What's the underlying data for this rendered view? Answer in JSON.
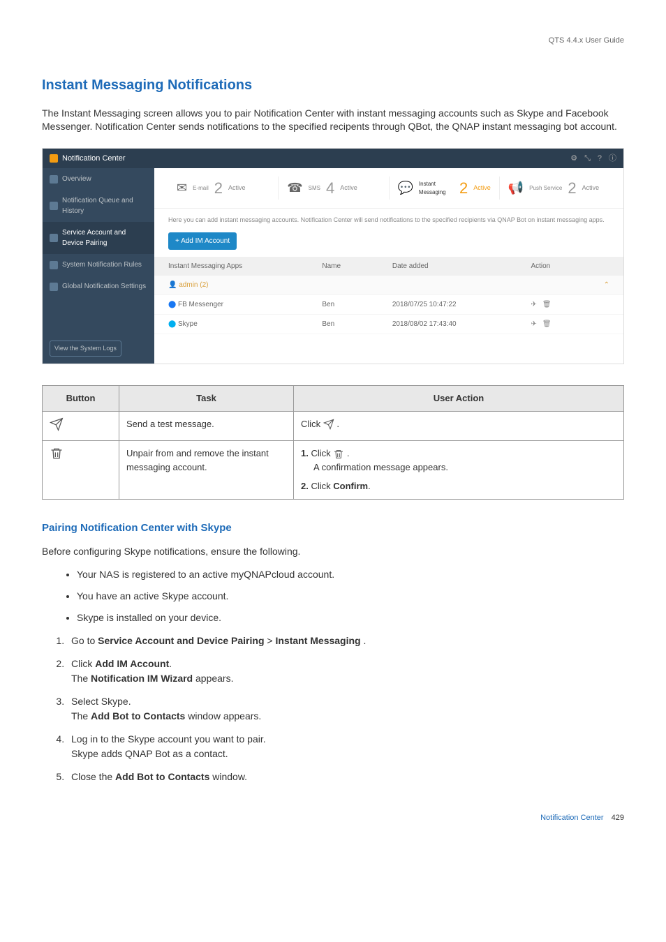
{
  "header": {
    "guide_title": "QTS 4.4.x User Guide"
  },
  "section": {
    "title": "Instant Messaging Notifications",
    "intro": "The Instant Messaging screen allows you to pair Notification Center with instant messaging accounts such as Skype and Facebook Messenger. Notification Center sends notifications to the specified recipents through QBot, the QNAP instant messaging bot account."
  },
  "screenshot": {
    "titlebar": "Notification Center",
    "sidebar": {
      "items": [
        {
          "label": "Overview"
        },
        {
          "label": "Notification Queue and History"
        },
        {
          "label": "Service Account and Device Pairing"
        },
        {
          "label": "System Notification Rules"
        },
        {
          "label": "Global Notification Settings"
        }
      ],
      "bottom_button": "View the System Logs"
    },
    "stats": [
      {
        "icon": "✉",
        "num": "2",
        "label": "Active",
        "sub": "E-mail"
      },
      {
        "icon": "☎",
        "num": "4",
        "label": "Active",
        "sub": "SMS"
      },
      {
        "icon": "💬",
        "num": "2",
        "label": "Active",
        "sub": "Instant Messaging",
        "highlight": true
      },
      {
        "icon": "📢",
        "num": "2",
        "label": "Active",
        "sub": "Push Service"
      }
    ],
    "desc": "Here you can add instant messaging accounts. Notification Center will send notifications to the specified recipients via QNAP Bot on instant messaging apps.",
    "add_button": "+ Add IM Account",
    "table": {
      "headers": [
        "Instant Messaging Apps",
        "Name",
        "Date added",
        "Action"
      ],
      "group": "admin (2)",
      "rows": [
        {
          "app": "FB Messenger",
          "name": "Ben",
          "date": "2018/07/25 10:47:22"
        },
        {
          "app": "Skype",
          "name": "Ben",
          "date": "2018/08/02 17:43:40"
        }
      ]
    }
  },
  "action_table": {
    "headers": [
      "Button",
      "Task",
      "User Action"
    ],
    "rows": [
      {
        "task": "Send a test message.",
        "action_prefix": "Click ",
        "action_suffix": "."
      },
      {
        "task": "Unpair from and remove the instant messaging account.",
        "step1_prefix": "Click ",
        "step1_suffix": ".",
        "step1_line2": "A confirmation message appears.",
        "step2_label": "2.",
        "step2_text_prefix": "Click ",
        "step2_bold": "Confirm",
        "step2_suffix": "."
      }
    ]
  },
  "subsection": {
    "title": "Pairing Notification Center with Skype",
    "intro": "Before configuring Skype notifications, ensure the following.",
    "bullets": [
      "Your NAS is registered to an active myQNAPcloud account.",
      "You have an active Skype account.",
      "Skype is installed on your device."
    ],
    "steps": [
      {
        "num": "1.",
        "prefix": "Go to ",
        "bold1": "Service Account and Device Pairing",
        "sep": " > ",
        "bold2": "Instant Messaging",
        "suffix": " ."
      },
      {
        "num": "2.",
        "line1_prefix": "Click ",
        "line1_bold": "Add IM Account",
        "line1_suffix": ".",
        "line2_prefix": "The ",
        "line2_bold": "Notification IM Wizard",
        "line2_suffix": " appears."
      },
      {
        "num": "3.",
        "line1": "Select Skype.",
        "line2_prefix": "The ",
        "line2_bold": "Add Bot to Contacts",
        "line2_suffix": " window appears."
      },
      {
        "num": "4.",
        "line1": "Log in to the Skype account you want to pair.",
        "line2": "Skype adds QNAP Bot as a contact."
      },
      {
        "num": "5.",
        "line1_prefix": "Close the ",
        "line1_bold": "Add Bot to Contacts",
        "line1_suffix": " window."
      }
    ]
  },
  "footer": {
    "section_name": "Notification Center",
    "page": "429"
  }
}
